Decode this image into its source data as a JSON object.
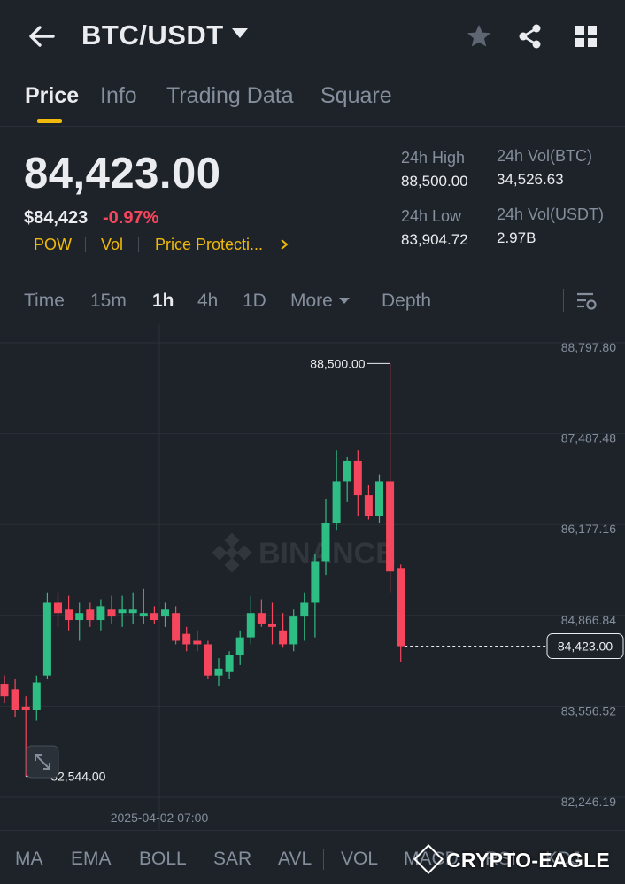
{
  "header": {
    "pair": "BTC/USDT"
  },
  "tabs": [
    {
      "label": "Price"
    },
    {
      "label": "Info"
    },
    {
      "label": "Trading Data"
    },
    {
      "label": "Square"
    }
  ],
  "ticker": {
    "last_price": "84,423.00",
    "usd_price": "$84,423",
    "change_pct": "-0.97%",
    "tags": [
      "POW",
      "Vol",
      "Price Protecti..."
    ],
    "stats": {
      "high_label": "24h High",
      "high_value": "88,500.00",
      "low_label": "24h Low",
      "low_value": "83,904.72",
      "vol_btc_label": "24h Vol(BTC)",
      "vol_btc_value": "34,526.63",
      "vol_usdt_label": "24h Vol(USDT)",
      "vol_usdt_value": "2.97B"
    }
  },
  "intervals": {
    "items": [
      "Time",
      "15m",
      "1h",
      "4h",
      "1D",
      "More",
      "Depth"
    ],
    "selected": "1h"
  },
  "chart": {
    "watermark": "BINANCE",
    "price_axis": [
      "88,797.80",
      "87,487.48",
      "86,177.16",
      "84,866.84",
      "83,556.52",
      "82,246.19"
    ],
    "last_price_label": "84,423.00",
    "high_label": "88,500.00",
    "low_label": "82,544.00",
    "time_label": "2025-04-02 07:00"
  },
  "chart_data": {
    "type": "candlestick",
    "interval": "1h",
    "ylim": [
      82246.19,
      88797.8
    ],
    "yticks": [
      88797.8,
      87487.48,
      86177.16,
      84866.84,
      83556.52,
      82246.19
    ],
    "last_price": 84423.0,
    "marked_high": 88500.0,
    "marked_low": 82544.0,
    "x_label": "2025-04-02 07:00",
    "candles": [
      {
        "o": 83880,
        "h": 84000,
        "l": 83600,
        "c": 83700
      },
      {
        "o": 83800,
        "h": 83950,
        "l": 83400,
        "c": 83500
      },
      {
        "o": 83550,
        "h": 83700,
        "l": 82544,
        "c": 83500
      },
      {
        "o": 83500,
        "h": 84000,
        "l": 83350,
        "c": 83900
      },
      {
        "o": 84000,
        "h": 85200,
        "l": 83950,
        "c": 85050
      },
      {
        "o": 85050,
        "h": 85200,
        "l": 84700,
        "c": 84900
      },
      {
        "o": 84950,
        "h": 85150,
        "l": 84650,
        "c": 84800
      },
      {
        "o": 84800,
        "h": 85050,
        "l": 84500,
        "c": 84900
      },
      {
        "o": 84950,
        "h": 85050,
        "l": 84700,
        "c": 84800
      },
      {
        "o": 84800,
        "h": 85100,
        "l": 84650,
        "c": 85000
      },
      {
        "o": 84950,
        "h": 85150,
        "l": 84750,
        "c": 84850
      },
      {
        "o": 84900,
        "h": 85150,
        "l": 84700,
        "c": 84950
      },
      {
        "o": 84900,
        "h": 85200,
        "l": 84750,
        "c": 84950
      },
      {
        "o": 84850,
        "h": 85250,
        "l": 84750,
        "c": 84900
      },
      {
        "o": 84900,
        "h": 85000,
        "l": 84750,
        "c": 84800
      },
      {
        "o": 84850,
        "h": 85050,
        "l": 84700,
        "c": 84950
      },
      {
        "o": 84900,
        "h": 85000,
        "l": 84450,
        "c": 84500
      },
      {
        "o": 84600,
        "h": 84700,
        "l": 84350,
        "c": 84450
      },
      {
        "o": 84500,
        "h": 84650,
        "l": 84350,
        "c": 84450
      },
      {
        "o": 84450,
        "h": 84500,
        "l": 83950,
        "c": 84000
      },
      {
        "o": 84000,
        "h": 84250,
        "l": 83850,
        "c": 84100
      },
      {
        "o": 84050,
        "h": 84350,
        "l": 83950,
        "c": 84300
      },
      {
        "o": 84300,
        "h": 84650,
        "l": 84150,
        "c": 84550
      },
      {
        "o": 84550,
        "h": 85150,
        "l": 84450,
        "c": 84900
      },
      {
        "o": 84900,
        "h": 85100,
        "l": 84700,
        "c": 84750
      },
      {
        "o": 84750,
        "h": 85050,
        "l": 84450,
        "c": 84700
      },
      {
        "o": 84650,
        "h": 84900,
        "l": 84400,
        "c": 84450
      },
      {
        "o": 84450,
        "h": 84950,
        "l": 84350,
        "c": 84850
      },
      {
        "o": 84850,
        "h": 85200,
        "l": 84500,
        "c": 85050
      },
      {
        "o": 85050,
        "h": 85750,
        "l": 84550,
        "c": 85650
      },
      {
        "o": 85650,
        "h": 86550,
        "l": 85450,
        "c": 86200
      },
      {
        "o": 86200,
        "h": 87250,
        "l": 86100,
        "c": 86800
      },
      {
        "o": 86800,
        "h": 87150,
        "l": 86500,
        "c": 87100
      },
      {
        "o": 87100,
        "h": 87250,
        "l": 86300,
        "c": 86600
      },
      {
        "o": 86600,
        "h": 86750,
        "l": 86250,
        "c": 86300
      },
      {
        "o": 86300,
        "h": 86900,
        "l": 86200,
        "c": 86800
      },
      {
        "o": 86800,
        "h": 88500,
        "l": 85200,
        "c": 85500
      },
      {
        "o": 85550,
        "h": 85600,
        "l": 84200,
        "c": 84423
      }
    ]
  },
  "indicators": [
    "MA",
    "EMA",
    "BOLL",
    "SAR",
    "AVL",
    "VOL",
    "MACD",
    "RSI",
    "KDJ"
  ],
  "watermark_text": "CRYPTO-EAGLE",
  "colors": {
    "background": "#1e2329",
    "up": "#2ebd85",
    "down": "#f6465d",
    "accent": "#f0b90b",
    "muted": "#848e9c"
  },
  "icons": [
    "back-arrow-icon",
    "caret-down-icon",
    "star-icon",
    "share-icon",
    "grid-icon",
    "chart-settings-icon",
    "expand-icon",
    "binance-logo-icon"
  ]
}
